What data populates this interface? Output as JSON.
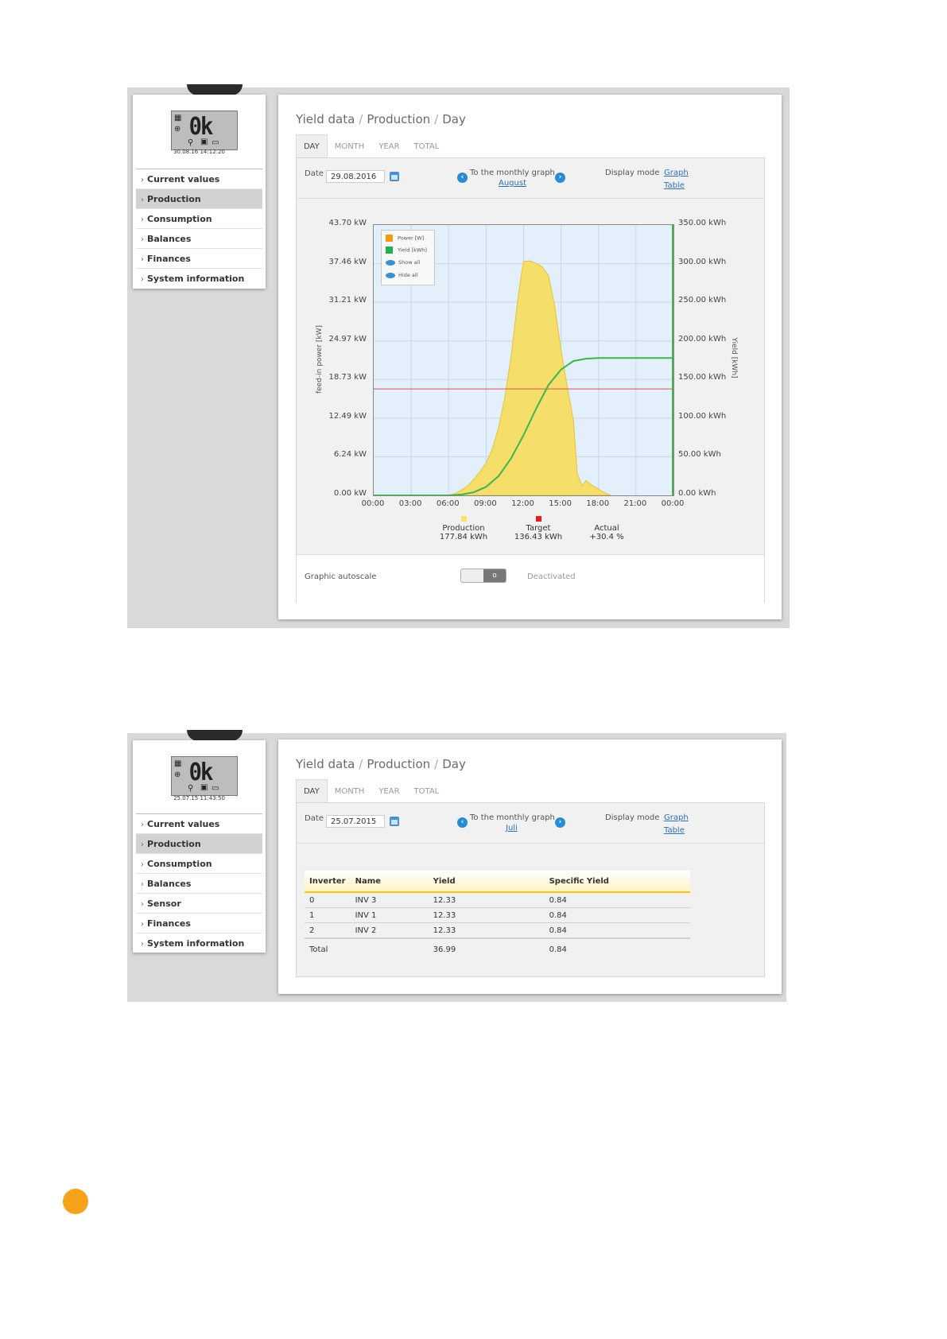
{
  "screens": [
    {
      "lcd": {
        "display": "0k",
        "timestamp": "30.08.16 14:12:20"
      },
      "sidebar": {
        "items": [
          {
            "label": "Current values"
          },
          {
            "label": "Production",
            "active": true
          },
          {
            "label": "Consumption"
          },
          {
            "label": "Balances"
          },
          {
            "label": "Finances"
          },
          {
            "label": "System information"
          }
        ]
      },
      "breadcrumb": {
        "part1": "Yield data",
        "part2": "Production",
        "part3": "Day"
      },
      "tabs": [
        "DAY",
        "MONTH",
        "YEAR",
        "TOTAL"
      ],
      "toolbar": {
        "date_label": "Date",
        "date_value": "29.08.2016",
        "monthly_label": "To the monthly graph",
        "monthly_month": "August",
        "display_mode_label": "Display mode",
        "graph_link": "Graph",
        "table_link": "Table"
      },
      "autoscale": {
        "label": "Graphic autoscale",
        "state": "Deactivated"
      }
    },
    {
      "lcd": {
        "display": "0k",
        "timestamp": "25.07.15 11:43:50"
      },
      "sidebar": {
        "items": [
          {
            "label": "Current values"
          },
          {
            "label": "Production",
            "active": true
          },
          {
            "label": "Consumption"
          },
          {
            "label": "Balances"
          },
          {
            "label": "Sensor"
          },
          {
            "label": "Finances"
          },
          {
            "label": "System information"
          }
        ]
      },
      "breadcrumb": {
        "part1": "Yield data",
        "part2": "Production",
        "part3": "Day"
      },
      "tabs": [
        "DAY",
        "MONTH",
        "YEAR",
        "TOTAL"
      ],
      "toolbar": {
        "date_label": "Date",
        "date_value": "25.07.2015",
        "monthly_label": "To the monthly graph",
        "monthly_month": "Juli",
        "display_mode_label": "Display mode",
        "graph_link": "Graph",
        "table_link": "Table"
      },
      "table": {
        "headers": [
          "Inverter",
          "Name",
          "Yield",
          "Specific Yield"
        ],
        "rows": [
          [
            "0",
            "INV 3",
            "12.33",
            "0.84"
          ],
          [
            "1",
            "INV 1",
            "12.33",
            "0.84"
          ],
          [
            "2",
            "INV 2",
            "12.33",
            "0.84"
          ]
        ],
        "total": [
          "Total",
          "",
          "36.99",
          "0.84"
        ]
      }
    }
  ],
  "chart_data": {
    "type": "area",
    "legend": {
      "items": [
        {
          "label": "Power [W]",
          "color": "#f39c12"
        },
        {
          "label": "Yield [kWh]",
          "color": "#22b14c"
        }
      ],
      "show_all": "Show all",
      "hide_all": "Hide all",
      "placement": "top-left"
    },
    "ylabel": "feed-in power [kW]",
    "ylabel_right": "Yield [kWh]",
    "y_ticks": [
      "0.00 kW",
      "6.24 kW",
      "12.49 kW",
      "18.73 kW",
      "24.97 kW",
      "31.21 kW",
      "37.46 kW",
      "43.70 kW"
    ],
    "y_ticks_right": [
      "0.00 kWh",
      "50.00 kWh",
      "100.00 kWh",
      "150.00 kWh",
      "200.00 kWh",
      "250.00 kWh",
      "300.00 kWh",
      "350.00 kWh"
    ],
    "x_ticks": [
      "00:00",
      "03:00",
      "06:00",
      "09:00",
      "12:00",
      "15:00",
      "18:00",
      "21:00",
      "00:00"
    ],
    "ylim": [
      0,
      43.7
    ],
    "ylim_right": [
      0,
      350
    ],
    "target_line_kw": 17.2,
    "power_series": {
      "name": "Power [W]",
      "color": "#f5df6a",
      "x": [
        6.0,
        6.5,
        7.0,
        7.5,
        8.0,
        8.5,
        9.0,
        9.5,
        10.0,
        10.5,
        11.0,
        11.5,
        11.8,
        12.0,
        12.5,
        13.0,
        13.5,
        14.0,
        14.5,
        15.0,
        15.5,
        16.0,
        16.3,
        16.7,
        17.0,
        17.5,
        18.0,
        18.5,
        19.0
      ],
      "y": [
        0,
        0.3,
        0.8,
        1.5,
        2.6,
        3.8,
        5.2,
        7.5,
        11.0,
        15.8,
        22.5,
        31.0,
        35.5,
        37.8,
        37.9,
        37.5,
        36.9,
        35.5,
        30.5,
        23.5,
        17.5,
        12.0,
        3.5,
        1.5,
        2.4,
        1.6,
        1.0,
        0.4,
        0
      ]
    },
    "yield_series": {
      "name": "Yield [kWh]",
      "color": "#3db54a",
      "x": [
        0,
        6.0,
        7.0,
        8.0,
        9.0,
        10.0,
        11.0,
        12.0,
        13.0,
        14.0,
        15.0,
        16.0,
        17.0,
        18.0,
        19.0,
        24.0
      ],
      "y": [
        0,
        0,
        1,
        4,
        11,
        25,
        48,
        78,
        112,
        143,
        163,
        174,
        177,
        177.8,
        177.84,
        177.84
      ]
    },
    "summary": [
      {
        "label": "Production",
        "value": "177.84 kWh",
        "color": "#f2e36b"
      },
      {
        "label": "Target",
        "value": "136.43 kWh",
        "color": "#e02020"
      },
      {
        "label": "Actual",
        "value": "+30.4 %"
      }
    ]
  }
}
